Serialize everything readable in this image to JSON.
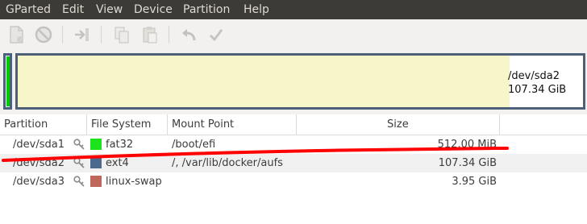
{
  "menubar": {
    "items": [
      "GParted",
      "Edit",
      "View",
      "Device",
      "Partition",
      "Help"
    ]
  },
  "toolbar": {
    "buttons": [
      "new-icon",
      "delete-icon",
      "resize-move-icon",
      "copy-icon",
      "paste-icon",
      "undo-icon",
      "apply-icon"
    ],
    "enabled": false
  },
  "diskmap": {
    "sda2": {
      "name": "/dev/sda2",
      "size": "107.34 GiB",
      "used_fraction": 0.87
    },
    "colors": {
      "sda1_fs": "#00cc00",
      "frame": "#4c6179",
      "used": "#f7f6c8"
    }
  },
  "table": {
    "headers": [
      "Partition",
      "File System",
      "Mount Point",
      "Size"
    ],
    "rows": [
      {
        "partition": "/dev/sda1",
        "fs": "fat32",
        "fs_color": "#1de31d",
        "mount": "/boot/efi",
        "size": "512.00 MiB"
      },
      {
        "partition": "/dev/sda2",
        "fs": "ext4",
        "fs_color": "#4c6a8e",
        "mount": "/, /var/lib/docker/aufs",
        "size": "107.34 GiB"
      },
      {
        "partition": "/dev/sda3",
        "fs": "linux-swap",
        "fs_color": "#c0675b",
        "mount": "",
        "size": "3.95 GiB"
      }
    ]
  },
  "annotation": {
    "color": "#ff0000"
  }
}
